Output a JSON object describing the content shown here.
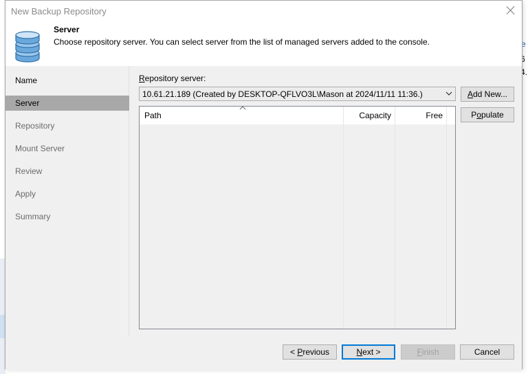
{
  "dialog": {
    "title": "New Backup Repository",
    "header_title": "Server",
    "header_description": "Choose repository server. You can select server from the list of managed servers added to the console."
  },
  "nav": {
    "items": [
      {
        "label": "Name"
      },
      {
        "label": "Server"
      },
      {
        "label": "Repository"
      },
      {
        "label": "Mount Server"
      },
      {
        "label": "Review"
      },
      {
        "label": "Apply"
      },
      {
        "label": "Summary"
      }
    ]
  },
  "content": {
    "repo_label_hotkey": "R",
    "repo_label_rest": "epository server:",
    "server_value": "10.61.21.189 (Created by DESKTOP-QFLVO3L\\Mason at 2024/11/11 11:36.)",
    "add_new_hotkey": "A",
    "add_new_rest": "dd New...",
    "populate_pre": "P",
    "populate_hotkey": "o",
    "populate_rest": "pulate",
    "columns": [
      "Path",
      "Capacity",
      "Free"
    ]
  },
  "footer": {
    "previous_pre": "< ",
    "previous_hotkey": "P",
    "previous_rest": "revious",
    "next_hotkey": "N",
    "next_rest": "ext >",
    "finish_hotkey": "F",
    "finish_rest": "inish",
    "cancel_label": "Cancel"
  },
  "background": {
    "link_fragment": "e",
    "text_fragment_1": "6",
    "text_fragment_2": "4."
  }
}
